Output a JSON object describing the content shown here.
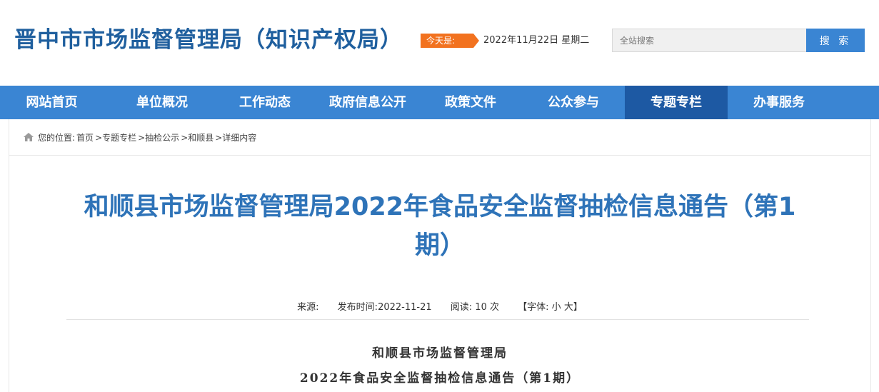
{
  "header": {
    "site_title": "晋中市市场监督管理局（知识产权局）",
    "today_label": "今天是:",
    "today_date": "2022年11月22日 星期二",
    "search_placeholder": "全站搜索",
    "search_button": "搜 索"
  },
  "nav": {
    "items": [
      {
        "label": "网站首页"
      },
      {
        "label": "单位概况"
      },
      {
        "label": "工作动态"
      },
      {
        "label": "政府信息公开"
      },
      {
        "label": "政策文件"
      },
      {
        "label": "公众参与"
      },
      {
        "label": "专题专栏"
      },
      {
        "label": "办事服务"
      }
    ],
    "active_index": 6
  },
  "breadcrumb": {
    "prefix": "您的位置:",
    "items": [
      "首页",
      ">专题专栏",
      ">抽检公示",
      ">和顺县",
      ">详细内容"
    ]
  },
  "article": {
    "title": "和顺县市场监督管理局2022年食品安全监督抽检信息通告（第1期）",
    "meta": {
      "source_label": "来源:",
      "publish_label": "发布时间:",
      "publish_date": "2022-11-21",
      "reads_label": "阅读:",
      "reads_count": "10",
      "reads_unit": "次",
      "font_label": "【字体:",
      "font_small": "小",
      "font_large": "大】"
    },
    "body_lines": [
      "和顺县市场监督管理局",
      "2022年食品安全监督抽检信息通告（第1期）"
    ]
  },
  "colors": {
    "brand_blue": "#3a85d3",
    "nav_active": "#1d59a3",
    "title_blue": "#2e73b8",
    "badge_orange": "#f2721f"
  }
}
